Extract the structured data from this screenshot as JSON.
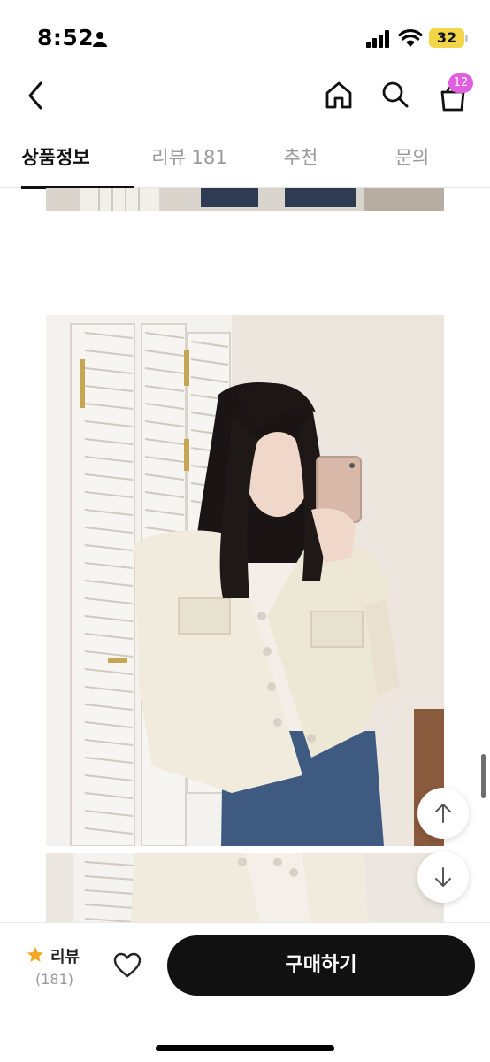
{
  "status_bar": {
    "time": "8:52",
    "battery": "32"
  },
  "nav": {
    "cart_badge": "12"
  },
  "tabs": [
    {
      "label": "상품정보",
      "active": true
    },
    {
      "label": "리뷰 181",
      "active": false
    },
    {
      "label": "추천",
      "active": false
    },
    {
      "label": "문의",
      "active": false
    }
  ],
  "bottom_bar": {
    "review_label": "리뷰",
    "review_count": "(181)",
    "buy_label": "구매하기"
  },
  "colors": {
    "badge": "#e25ee0",
    "star": "#f5a623",
    "buy_button": "#111111",
    "battery": "#f3d548"
  },
  "icons": [
    "person-icon",
    "signal-icon",
    "wifi-icon",
    "back-icon",
    "home-icon",
    "search-icon",
    "cart-icon",
    "arrow-up-icon",
    "arrow-down-icon",
    "star-icon",
    "heart-icon"
  ]
}
